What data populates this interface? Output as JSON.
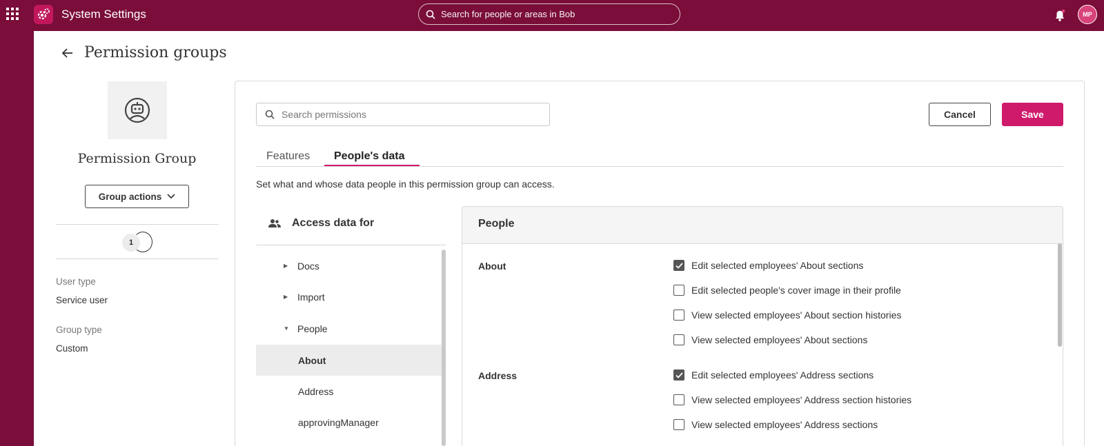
{
  "topbar": {
    "title": "System Settings",
    "search_placeholder": "Search for people or areas in Bob",
    "avatar_initials": "MP"
  },
  "page": {
    "title": "Permission groups"
  },
  "group": {
    "name": "Permission Group",
    "actions_label": "Group actions",
    "member_count": "1",
    "user_type_label": "User type",
    "user_type_value": "Service user",
    "group_type_label": "Group type",
    "group_type_value": "Custom"
  },
  "toolbar": {
    "search_placeholder": "Search permissions",
    "cancel_label": "Cancel",
    "save_label": "Save"
  },
  "tabs": [
    {
      "label": "Features",
      "active": false
    },
    {
      "label": "People's data",
      "active": true
    }
  ],
  "description": "Set what and whose data people in this permission group can access.",
  "access": {
    "header": "Access data for",
    "items": [
      {
        "label": "Docs",
        "caret": "right"
      },
      {
        "label": "Import",
        "caret": "right"
      },
      {
        "label": "People",
        "caret": "down"
      },
      {
        "label": "About",
        "selected": true
      },
      {
        "label": "Address"
      },
      {
        "label": "approvingManager"
      }
    ]
  },
  "people": {
    "header": "People",
    "sections": [
      {
        "label": "About",
        "permissions": [
          {
            "label": "Edit selected employees' About sections",
            "checked": true
          },
          {
            "label": "Edit selected people's cover image in their profile",
            "checked": false
          },
          {
            "label": "View selected employees' About section histories",
            "checked": false
          },
          {
            "label": "View selected employees' About sections",
            "checked": false
          }
        ]
      },
      {
        "label": "Address",
        "permissions": [
          {
            "label": "Edit selected employees' Address sections",
            "checked": true
          },
          {
            "label": "View selected employees' Address section histories",
            "checked": false
          },
          {
            "label": "View selected employees' Address sections",
            "checked": false
          }
        ]
      }
    ]
  },
  "colors": {
    "brand": "#7a0d3a",
    "accent": "#cf1a6c"
  }
}
